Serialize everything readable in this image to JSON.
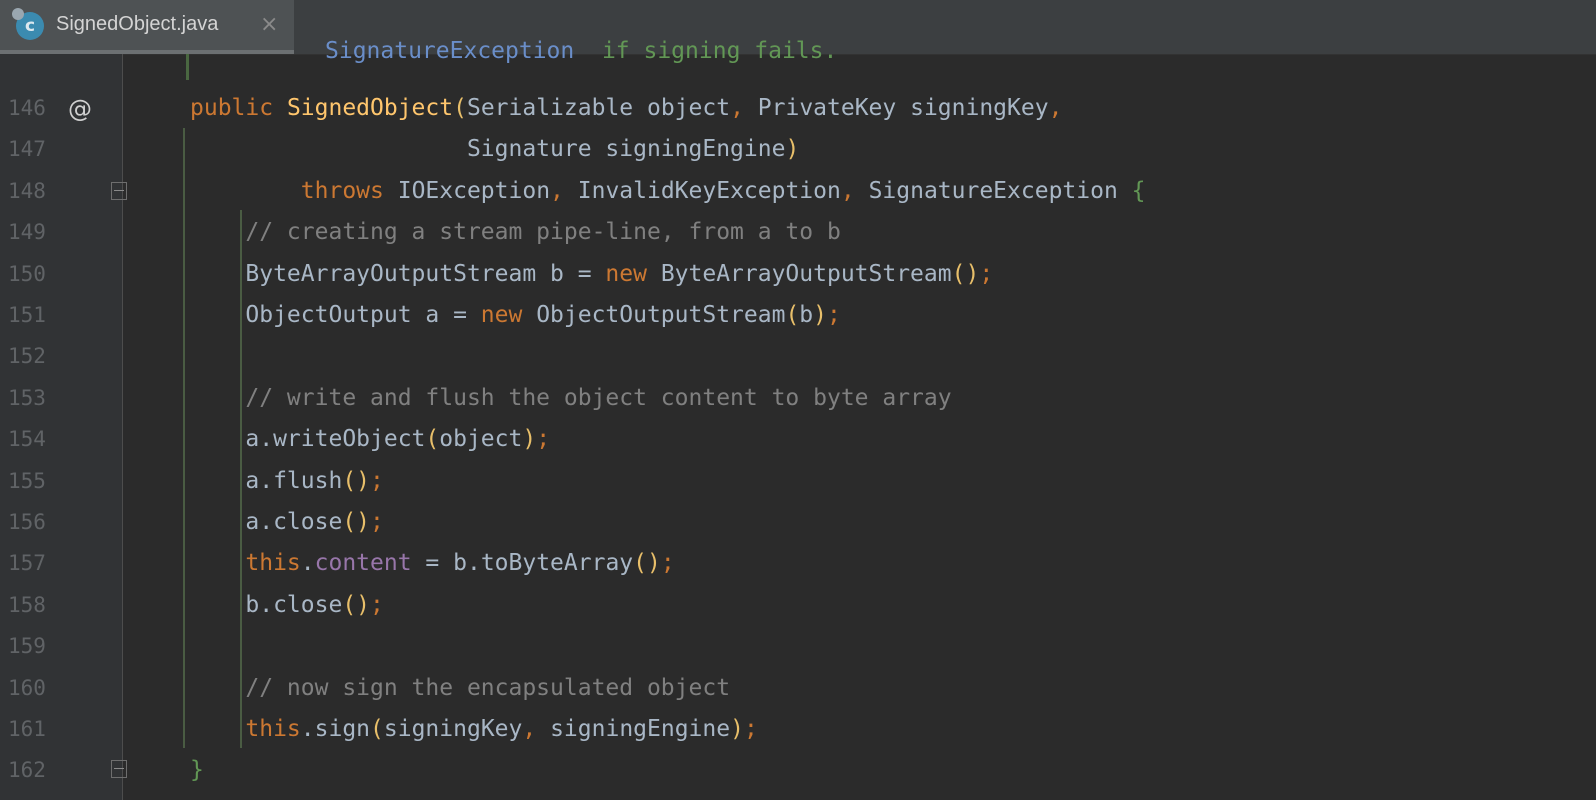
{
  "tab": {
    "title": "SignedObject.java",
    "close": "×",
    "icon_letter": "c"
  },
  "doc_top": {
    "tag": "SignatureException",
    "text": "  if signing fails."
  },
  "lines": [
    {
      "n": "146"
    },
    {
      "n": "147"
    },
    {
      "n": "148"
    },
    {
      "n": "149"
    },
    {
      "n": "150"
    },
    {
      "n": "151"
    },
    {
      "n": "152"
    },
    {
      "n": "153"
    },
    {
      "n": "154"
    },
    {
      "n": "155"
    },
    {
      "n": "156"
    },
    {
      "n": "157"
    },
    {
      "n": "158"
    },
    {
      "n": "159"
    },
    {
      "n": "160"
    },
    {
      "n": "161"
    },
    {
      "n": "162"
    }
  ],
  "code": {
    "l146": [
      [
        "kw",
        "public "
      ],
      [
        "fn",
        "SignedObject"
      ],
      [
        "pa",
        "("
      ],
      [
        "",
        "Serializable object"
      ],
      [
        "pu",
        ", "
      ],
      [
        "",
        "PrivateKey signingKey"
      ],
      [
        "pu",
        ","
      ]
    ],
    "l147": [
      [
        "",
        "                    Signature signingEngine"
      ],
      [
        "pa",
        ")"
      ]
    ],
    "l148": [
      [
        "kw",
        "        throws "
      ],
      [
        "",
        "IOException"
      ],
      [
        "pu",
        ", "
      ],
      [
        "",
        "InvalidKeyException"
      ],
      [
        "pu",
        ", "
      ],
      [
        "",
        "SignatureException "
      ],
      [
        "br",
        "{"
      ]
    ],
    "l149": [
      [
        "cm",
        "    // creating a stream pipe-line, from a to b"
      ]
    ],
    "l150": [
      [
        "",
        "    ByteArrayOutputStream b = "
      ],
      [
        "kw",
        "new "
      ],
      [
        "",
        "ByteArrayOutputStream"
      ],
      [
        "pa",
        "()"
      ],
      [
        "pu",
        ";"
      ]
    ],
    "l151": [
      [
        "",
        "    ObjectOutput a = "
      ],
      [
        "kw",
        "new "
      ],
      [
        "",
        "ObjectOutputStream"
      ],
      [
        "pa",
        "("
      ],
      [
        "",
        "b"
      ],
      [
        "pa",
        ")"
      ],
      [
        "pu",
        ";"
      ]
    ],
    "l152": [
      [
        "",
        ""
      ]
    ],
    "l153": [
      [
        "cm",
        "    // write and flush the object content to byte array"
      ]
    ],
    "l154": [
      [
        "",
        "    a.writeObject"
      ],
      [
        "pa",
        "("
      ],
      [
        "",
        "object"
      ],
      [
        "pa",
        ")"
      ],
      [
        "pu",
        ";"
      ]
    ],
    "l155": [
      [
        "",
        "    a.flush"
      ],
      [
        "pa",
        "()"
      ],
      [
        "pu",
        ";"
      ]
    ],
    "l156": [
      [
        "",
        "    a.close"
      ],
      [
        "pa",
        "()"
      ],
      [
        "pu",
        ";"
      ]
    ],
    "l157": [
      [
        "kw",
        "    this"
      ],
      [
        "",
        "."
      ],
      [
        "fd",
        "content"
      ],
      [
        "",
        " = b.toByteArray"
      ],
      [
        "pa",
        "()"
      ],
      [
        "pu",
        ";"
      ]
    ],
    "l158": [
      [
        "",
        "    b.close"
      ],
      [
        "pa",
        "()"
      ],
      [
        "pu",
        ";"
      ]
    ],
    "l159": [
      [
        "",
        ""
      ]
    ],
    "l160": [
      [
        "cm",
        "    // now sign the encapsulated object"
      ]
    ],
    "l161": [
      [
        "kw",
        "    this"
      ],
      [
        "",
        ".sign"
      ],
      [
        "pa",
        "("
      ],
      [
        "",
        "signingKey"
      ],
      [
        "pu",
        ", "
      ],
      [
        "",
        "signingEngine"
      ],
      [
        "pa",
        ")"
      ],
      [
        "pu",
        ";"
      ]
    ],
    "l162": [
      [
        "br",
        "}"
      ]
    ]
  },
  "gutter": {
    "override_icon": "@"
  },
  "colors": {
    "keyword": "#cc7832",
    "method": "#ffc66d",
    "comment": "#808080",
    "field": "#9876aa",
    "text": "#a9b7c6",
    "bg": "#2b2b2b"
  }
}
